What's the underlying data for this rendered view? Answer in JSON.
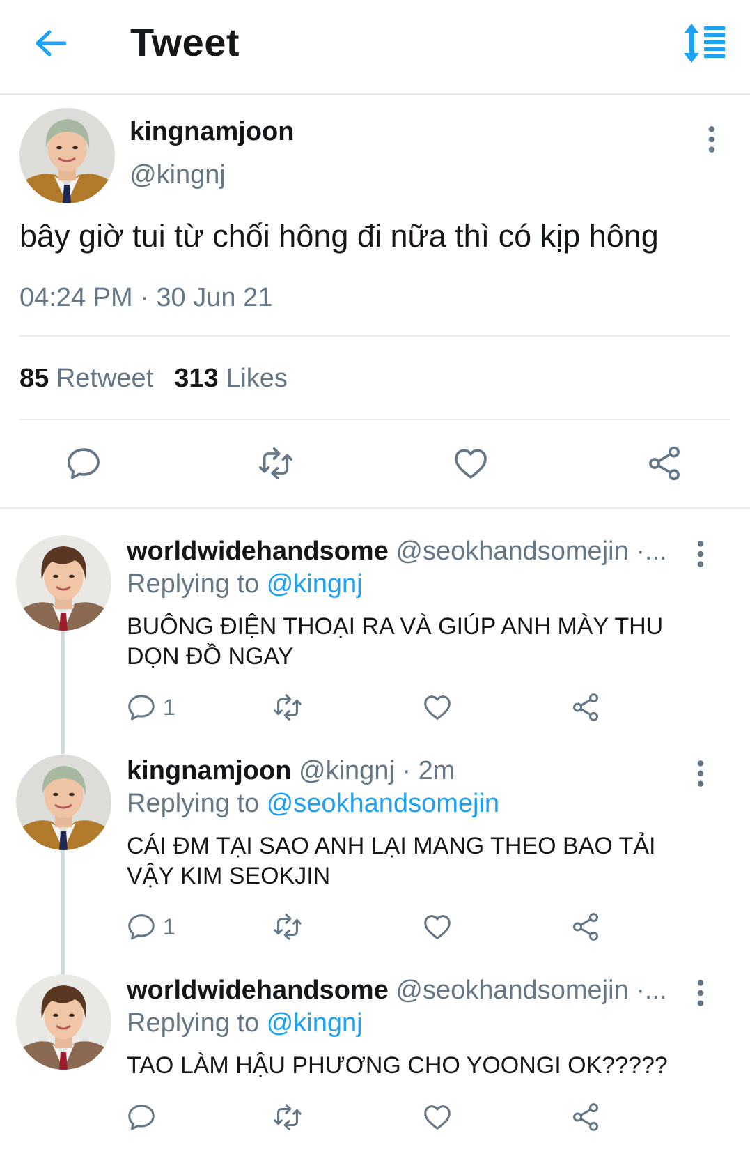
{
  "header": {
    "title": "Tweet"
  },
  "main_tweet": {
    "display_name": "kingnamjoon",
    "handle": "@kingnj",
    "text": "bây giờ tui từ chối hông đi nữa thì có kịp hông",
    "timestamp": "04:24 PM · 30 Jun 21",
    "retweets_count": "85",
    "retweets_label": "Retweet",
    "likes_count": "313",
    "likes_label": "Likes"
  },
  "replies": [
    {
      "display_name": "worldwidehandsome",
      "meta": "@seokhandsomejin ·...",
      "replying_prefix": "Replying to",
      "replying_to": "@kingnj",
      "text": "BUÔNG ĐIỆN THOẠI RA VÀ GIÚP ANH MÀY THU DỌN ĐỒ NGAY",
      "reply_count": "1"
    },
    {
      "display_name": "kingnamjoon",
      "meta": "@kingnj · 2m",
      "replying_prefix": "Replying to",
      "replying_to": "@seokhandsomejin",
      "text": "CÁI ĐM TẠI SAO ANH LẠI MANG THEO BAO TẢI VẬY KIM SEOKJIN",
      "reply_count": "1"
    },
    {
      "display_name": "worldwidehandsome",
      "meta": "@seokhandsomejin ·...",
      "replying_prefix": "Replying to",
      "replying_to": "@kingnj",
      "text": "TAO LÀM HẬU PHƯƠNG CHO YOONGI OK?????",
      "reply_count": ""
    }
  ],
  "colors": {
    "accent": "#1da1f2",
    "muted": "#657786",
    "text": "#14171a",
    "divider": "#e6ecf0"
  },
  "icons": [
    "back-arrow-icon",
    "sort-icon",
    "more-vertical-icon",
    "reply-icon",
    "retweet-icon",
    "like-icon",
    "share-icon"
  ]
}
